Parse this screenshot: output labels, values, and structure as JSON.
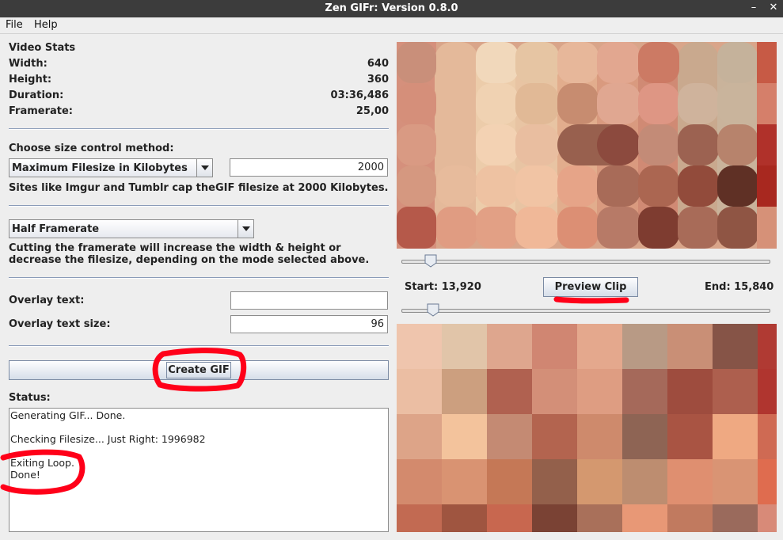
{
  "window": {
    "title": "Zen GIFr: Version 0.8.0",
    "minimize_glyph": "–",
    "close_glyph": "✕"
  },
  "menu": {
    "items": [
      "File",
      "Help"
    ]
  },
  "stats": {
    "heading": "Video Stats",
    "width_label": "Width:",
    "width_value": "640",
    "height_label": "Height:",
    "height_value": "360",
    "duration_label": "Duration:",
    "duration_value": "03:36,486",
    "framerate_label": "Framerate:",
    "framerate_value": "25,00"
  },
  "size_control": {
    "label": "Choose size control method:",
    "method_selected": "Maximum Filesize in Kilobytes",
    "filesize_value": "2000",
    "hint": "Sites like Imgur and Tumblr cap theGIF filesize at 2000 Kilobytes."
  },
  "framerate_control": {
    "selected": "Half Framerate",
    "hint_line1": "Cutting the framerate will increase the width & height or",
    "hint_line2": "decrease the filesize, depending on the mode selected above."
  },
  "overlay": {
    "text_label": "Overlay text:",
    "text_value": "",
    "size_label": "Overlay text size:",
    "size_value": "96"
  },
  "actions": {
    "create_gif_label": "Create GIF"
  },
  "status": {
    "label": "Status:",
    "lines": [
      "Generating GIF... Done.",
      "",
      "Checking Filesize... Just Right: 1996982",
      "",
      "Exiting Loop.",
      "Done!"
    ]
  },
  "clip": {
    "start_label": "Start: 13,920",
    "end_label": "End: 15,840",
    "preview_label": "Preview Clip",
    "start_position": 0.065,
    "end_position": 0.07
  },
  "colors": {
    "titlebar": "#3c3c3c",
    "background": "#eeeeee",
    "separator": "#8a9bb8",
    "annotation": "#ff0019"
  },
  "icons": {
    "minimize": "minimize-icon",
    "close": "close-icon",
    "dropdown": "chevron-down-icon"
  }
}
